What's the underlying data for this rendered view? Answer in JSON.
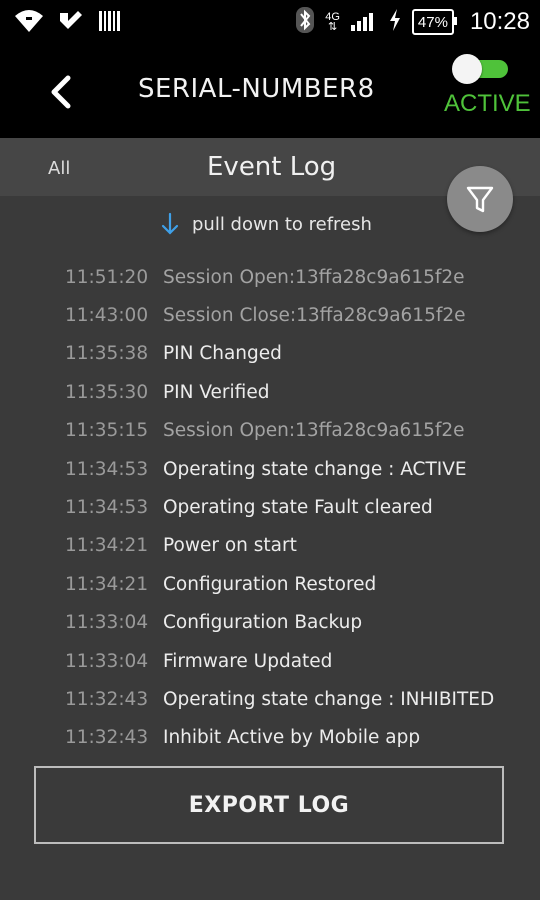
{
  "status_bar": {
    "network": "4G",
    "battery": "47%",
    "time": "10:28",
    "icons": [
      "wifi-icon",
      "check-notification-icon",
      "barcode-icon",
      "bluetooth-icon",
      "signal-icon",
      "charging-icon"
    ]
  },
  "app_bar": {
    "title": "SERIAL-NUMBER8",
    "status": "ACTIVE",
    "toggle_on": true,
    "accent": "#4fc23a"
  },
  "tabs": {
    "filter_label": "All",
    "title": "Event Log"
  },
  "refresh_hint": "pull down to refresh",
  "log": [
    {
      "time": "11:51:20",
      "message": "Session Open:13ffa28c9a615f2e"
    },
    {
      "time": "11:43:00",
      "message": "Session Close:13ffa28c9a615f2e"
    },
    {
      "time": "11:35:38",
      "message": "PIN Changed"
    },
    {
      "time": "11:35:30",
      "message": "PIN Verified"
    },
    {
      "time": "11:35:15",
      "message": "Session Open:13ffa28c9a615f2e"
    },
    {
      "time": "11:34:53",
      "message": "Operating state change : ACTIVE"
    },
    {
      "time": "11:34:53",
      "message": "Operating state Fault cleared"
    },
    {
      "time": "11:34:21",
      "message": "Power on start"
    },
    {
      "time": "11:34:21",
      "message": "Configuration Restored"
    },
    {
      "time": "11:33:04",
      "message": "Configuration Backup"
    },
    {
      "time": "11:33:04",
      "message": "Firmware Updated"
    },
    {
      "time": "11:32:43",
      "message": "Operating state change : INHIBITED"
    },
    {
      "time": "11:32:43",
      "message": "Inhibit Active by Mobile app"
    }
  ],
  "export_button": "EXPORT LOG"
}
